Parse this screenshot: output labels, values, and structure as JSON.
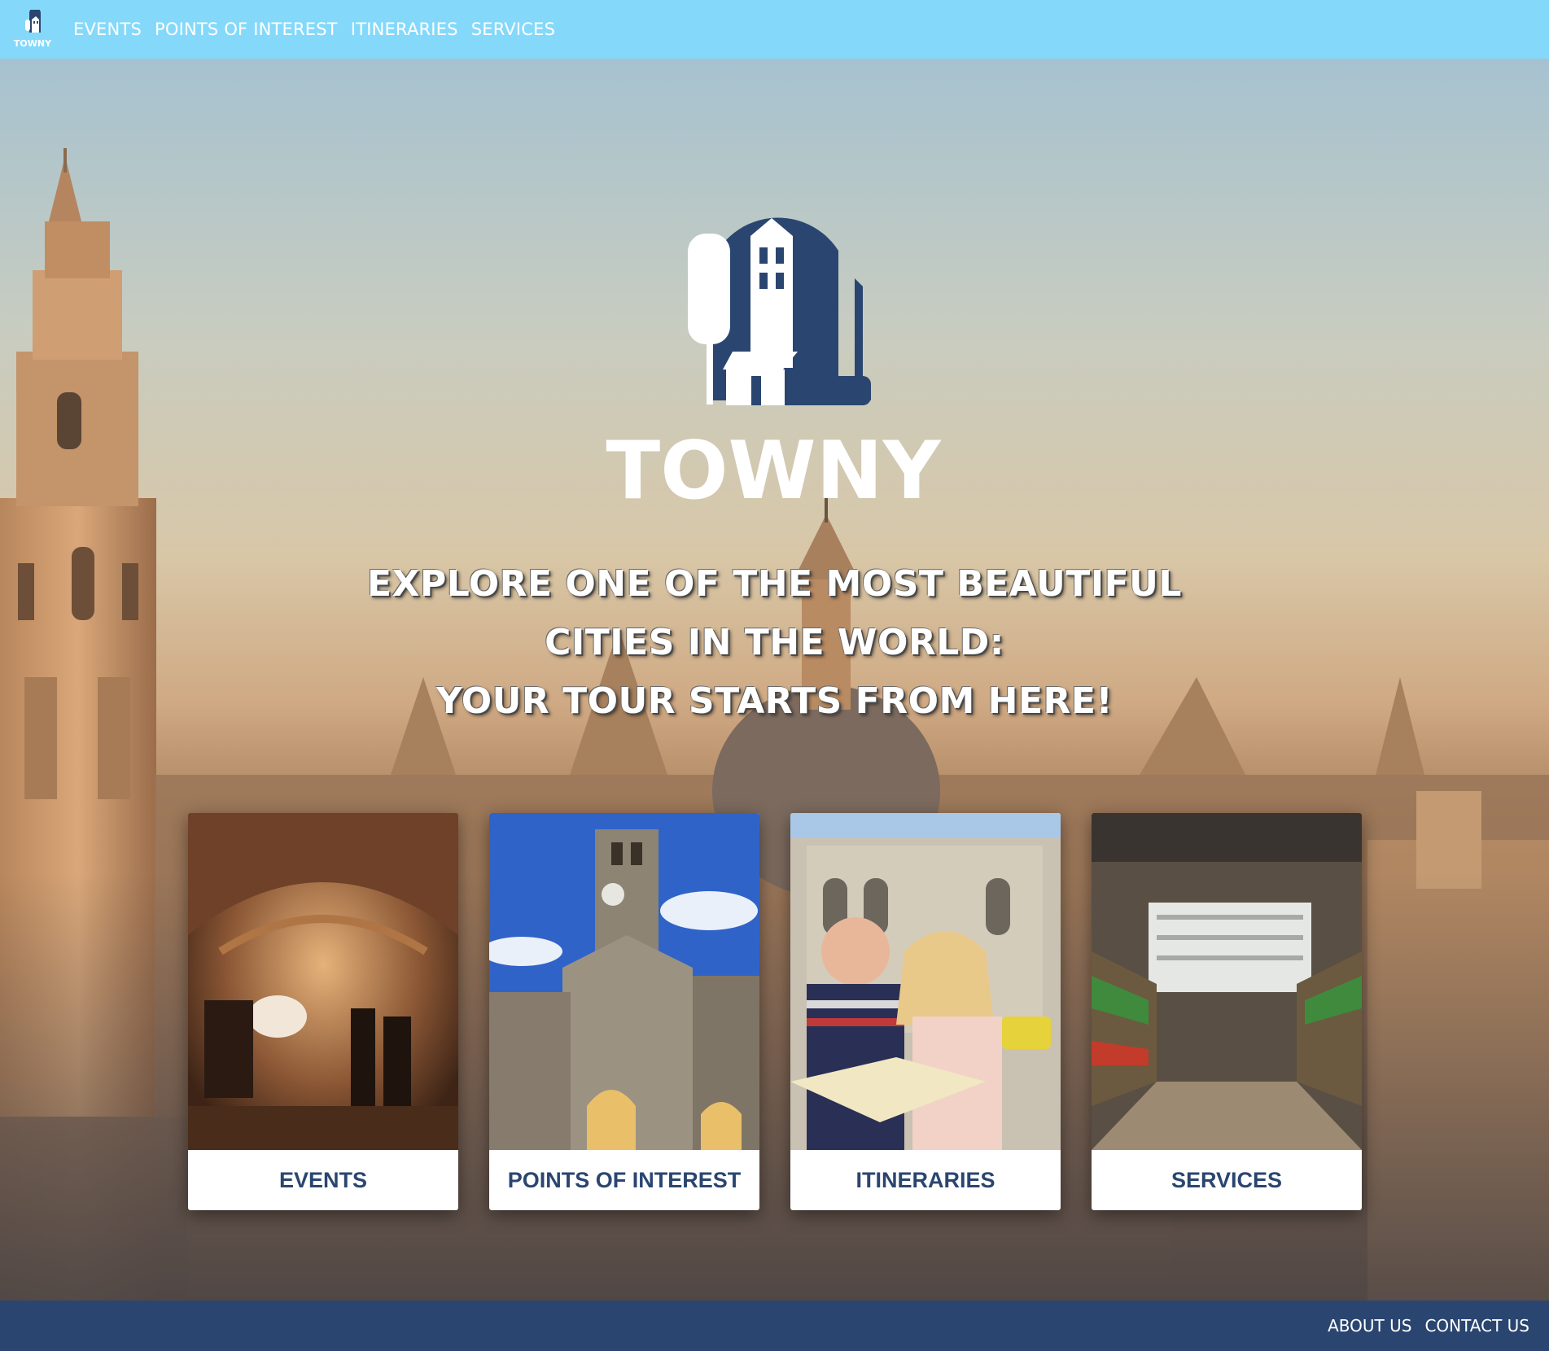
{
  "nav": {
    "logo_text": "TOWNY",
    "items": [
      {
        "label": "EVENTS"
      },
      {
        "label": "POINTS OF INTEREST"
      },
      {
        "label": "ITINERARIES"
      },
      {
        "label": "SERVICES"
      }
    ]
  },
  "hero": {
    "logo_text": "TOWNY",
    "title_lines": [
      "EXPLORE ONE OF THE MOST BEAUTIFUL",
      "CITIES IN THE WORLD:",
      "YOUR TOUR STARTS FROM HERE!"
    ]
  },
  "cards": [
    {
      "label": "EVENTS",
      "image": "event-hall-photo"
    },
    {
      "label": "POINTS OF INTEREST",
      "image": "clock-tower-photo"
    },
    {
      "label": "ITINERARIES",
      "image": "tourists-map-photo"
    },
    {
      "label": "SERVICES",
      "image": "supermarket-photo"
    }
  ],
  "footer": {
    "links": [
      {
        "label": "ABOUT US"
      },
      {
        "label": "CONTACT US"
      }
    ]
  },
  "colors": {
    "navbar": "#84d9fb",
    "brand_blue": "#2a4670",
    "footer": "#2a4670",
    "card_label": "#2a4670"
  }
}
